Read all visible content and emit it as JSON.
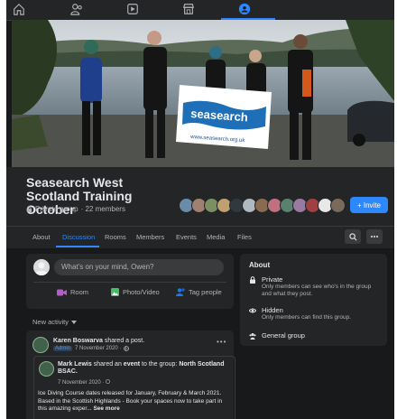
{
  "topnav": {
    "icons": [
      "home-icon",
      "friends-icon",
      "watch-icon",
      "marketplace-icon",
      "groups-icon"
    ]
  },
  "cover": {
    "banner_text": "seasearch",
    "banner_url": "www.seasearch.org.uk"
  },
  "group": {
    "title": "Seasearch West Scotland Training October",
    "privacy": "Private group",
    "members": "· 22 members",
    "invite_label": "+ Invite"
  },
  "tabs": [
    {
      "label": "About"
    },
    {
      "label": "Discussion"
    },
    {
      "label": "Rooms"
    },
    {
      "label": "Members"
    },
    {
      "label": "Events"
    },
    {
      "label": "Media"
    },
    {
      "label": "Files"
    }
  ],
  "composer": {
    "placeholder": "What's on your mind, Owen?",
    "room_label": "Room",
    "photo_label": "Photo/Video",
    "tag_label": "Tag people"
  },
  "feed": {
    "new_activity": "New activity"
  },
  "post": {
    "author": "Karen Boswarva",
    "action": "shared a post.",
    "badge": "Admin",
    "date": "7 November 2020 ·",
    "inner_author": "Mark Lewis",
    "inner_action": "shared an",
    "inner_event": "event",
    "inner_action2": "to the group:",
    "inner_group": "North Scotland BSAC.",
    "inner_date": "7 November 2020 ·",
    "line1": "Ice Diving Course dates released for January, February & March 2021.",
    "line2": "Based in the Scottish Highlands - Book your spaces now to take part in this amazing exper...",
    "see_more": "See more"
  },
  "about": {
    "heading": "About",
    "private_title": "Private",
    "private_desc": "Only members can see who's in the group and what they post.",
    "hidden_title": "Hidden",
    "hidden_desc": "Only members can find this group.",
    "general_title": "General group"
  },
  "colors": {
    "background": "#18191a",
    "card": "#242526",
    "accent": "#2d88ff",
    "text": "#e4e6eb",
    "muted": "#b0b3b8"
  }
}
